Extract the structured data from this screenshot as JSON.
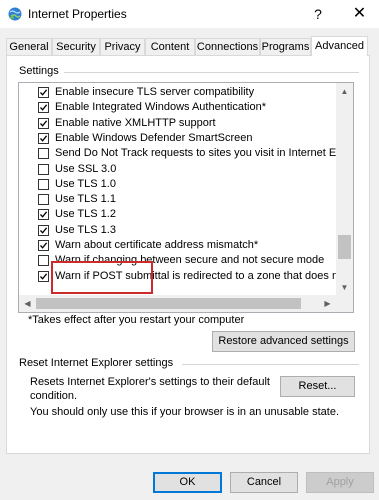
{
  "window": {
    "title": "Internet Properties",
    "help_glyph": "?",
    "close_glyph": "✕"
  },
  "tabs": [
    {
      "label": "General"
    },
    {
      "label": "Security"
    },
    {
      "label": "Privacy"
    },
    {
      "label": "Content"
    },
    {
      "label": "Connections"
    },
    {
      "label": "Programs"
    },
    {
      "label": "Advanced",
      "active": true
    }
  ],
  "settings": {
    "group_label": "Settings",
    "items": [
      {
        "label": "Enable insecure TLS server compatibility",
        "checked": true
      },
      {
        "label": "Enable Integrated Windows Authentication*",
        "checked": true
      },
      {
        "label": "Enable native XMLHTTP support",
        "checked": true
      },
      {
        "label": "Enable Windows Defender SmartScreen",
        "checked": true
      },
      {
        "label": "Send Do Not Track requests to sites you visit in Internet E",
        "checked": false
      },
      {
        "label": "Use SSL 3.0",
        "checked": false
      },
      {
        "label": "Use TLS 1.0",
        "checked": false
      },
      {
        "label": "Use TLS 1.1",
        "checked": false
      },
      {
        "label": "Use TLS 1.2",
        "checked": true
      },
      {
        "label": "Use TLS 1.3",
        "checked": true
      },
      {
        "label": "Warn about certificate address mismatch*",
        "checked": true
      },
      {
        "label": "Warn if changing between secure and not secure mode",
        "checked": false
      },
      {
        "label": "Warn if POST submittal is redirected to a zone that does n",
        "checked": true
      }
    ],
    "note": "*Takes effect after you restart your computer",
    "restore_button": "Restore advanced settings"
  },
  "reset": {
    "group_label": "Reset Internet Explorer settings",
    "description": "Resets Internet Explorer's settings to their default condition.",
    "button": "Reset...",
    "note": "You should only use this if your browser is in an unusable state."
  },
  "footer": {
    "ok": "OK",
    "cancel": "Cancel",
    "apply": "Apply"
  },
  "colors": {
    "highlight_border": "#cc2b2b",
    "default_button_border": "#0078d7"
  }
}
